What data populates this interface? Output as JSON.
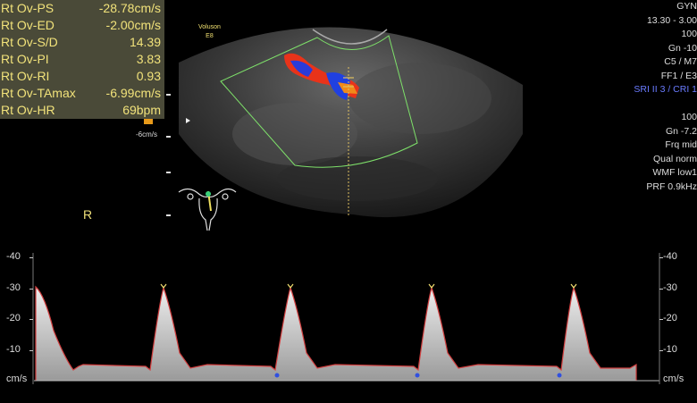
{
  "measurements": [
    {
      "label": "Rt Ov-PS",
      "value": "-28.78cm/s"
    },
    {
      "label": "Rt Ov-ED",
      "value": "-2.00cm/s"
    },
    {
      "label": "Rt Ov-S/D",
      "value": "14.39"
    },
    {
      "label": "Rt Ov-PI",
      "value": "3.83"
    },
    {
      "label": "Rt Ov-RI",
      "value": "0.93"
    },
    {
      "label": "Rt Ov-TAmax",
      "value": "-6.99cm/s"
    },
    {
      "label": "Rt Ov-HR",
      "value": "69bpm"
    }
  ],
  "color_scale_label": "-6cm/s",
  "brand": {
    "line1": "Voluson",
    "line2": "E8"
  },
  "side_marker": "R",
  "right_info": {
    "lines": [
      "GYN",
      "13.30 - 3.00",
      "100",
      "Gn -10",
      "C5 / M7",
      "FF1 / E3",
      "SRI II 3 / CRI 1",
      "",
      "100",
      "Gn -7.2",
      "Frq mid",
      "Qual norm",
      "WMF low1",
      "PRF  0.9kHz"
    ]
  },
  "spectral_axis": {
    "labels": [
      "-40",
      "-30",
      "-20",
      "-10",
      "cm/s"
    ],
    "values": [
      -40,
      -30,
      -20,
      -10,
      0
    ]
  },
  "colors": {
    "measure_text": "#f1e27a",
    "measure_bg": "#4a4a38",
    "sector_box": "#7ee06a",
    "envelope": "#d24040",
    "trace": "#f0e8b0",
    "blue_text": "#6a7bff"
  }
}
